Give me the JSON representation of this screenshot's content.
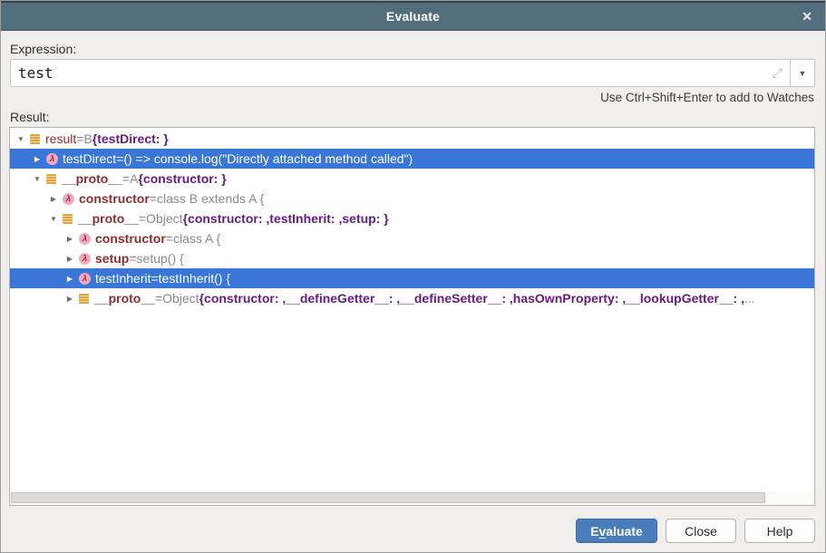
{
  "window": {
    "title": "Evaluate",
    "close_icon": "✕"
  },
  "expression": {
    "label": "Expression:",
    "value": "test",
    "expand_icon": "⤢",
    "dropdown_icon": "▼"
  },
  "hint": "Use Ctrl+Shift+Enter to add to Watches",
  "result_label": "Result:",
  "icons": {
    "expanded": "▼",
    "collapsed": "▶",
    "lambda": "λ"
  },
  "colors": {
    "titlebar": "#526e7c",
    "selection": "#3a76d8",
    "name_text": "#8b2f2e",
    "preview_text": "#671c81",
    "dim_text": "#8a8a8a",
    "object_icon": "#e2a33c",
    "lambda_icon_bg": "#f2a9ba",
    "primary_button": "#4a7cbb"
  },
  "tree": {
    "rows": [
      {
        "level": 0,
        "expander": "expanded",
        "icon": "object",
        "selected": false,
        "name": "result",
        "name_bold": false,
        "eq": " = ",
        "value": "B ",
        "preview": "{testDirect: }",
        "suffix": ""
      },
      {
        "level": 1,
        "expander": "collapsed",
        "icon": "function",
        "selected": true,
        "name": "testDirect",
        "name_bold": false,
        "eq": " = ",
        "value": "() => console.log(\"Directly attached method called\")",
        "preview": "",
        "suffix": ""
      },
      {
        "level": 1,
        "expander": "expanded",
        "icon": "object",
        "selected": false,
        "name": "__proto__",
        "name_bold": true,
        "eq": " = ",
        "value": "A ",
        "preview": "{constructor: }",
        "suffix": ""
      },
      {
        "level": 2,
        "expander": "collapsed",
        "icon": "function",
        "selected": false,
        "name": "constructor",
        "name_bold": true,
        "eq": " = ",
        "value": "class B extends A {",
        "preview": "",
        "suffix": ""
      },
      {
        "level": 2,
        "expander": "expanded",
        "icon": "object",
        "selected": false,
        "name": "__proto__",
        "name_bold": true,
        "eq": " = ",
        "value": "Object ",
        "preview": "{constructor: ,testInherit: ,setup: }",
        "suffix": ""
      },
      {
        "level": 3,
        "expander": "collapsed",
        "icon": "function",
        "selected": false,
        "name": "constructor",
        "name_bold": true,
        "eq": " = ",
        "value": "class A {",
        "preview": "",
        "suffix": ""
      },
      {
        "level": 3,
        "expander": "collapsed",
        "icon": "function",
        "selected": false,
        "name": "setup",
        "name_bold": true,
        "eq": " = ",
        "value": "setup() {",
        "preview": "",
        "suffix": ""
      },
      {
        "level": 3,
        "expander": "collapsed",
        "icon": "function",
        "selected": true,
        "name": "testInherit",
        "name_bold": false,
        "eq": " = ",
        "value": "testInherit() {",
        "preview": "",
        "suffix": ""
      },
      {
        "level": 3,
        "expander": "collapsed",
        "icon": "object",
        "selected": false,
        "name": "__proto__",
        "name_bold": true,
        "eq": " = ",
        "value": "Object ",
        "preview": "{constructor: ,__defineGetter__: ,__defineSetter__: ,hasOwnProperty: ,__lookupGetter__: ,",
        "suffix": "..."
      }
    ]
  },
  "buttons": {
    "evaluate": {
      "prefix": "E",
      "mnemonic": "v",
      "suffix": "aluate"
    },
    "close": "Close",
    "help": "Help"
  }
}
